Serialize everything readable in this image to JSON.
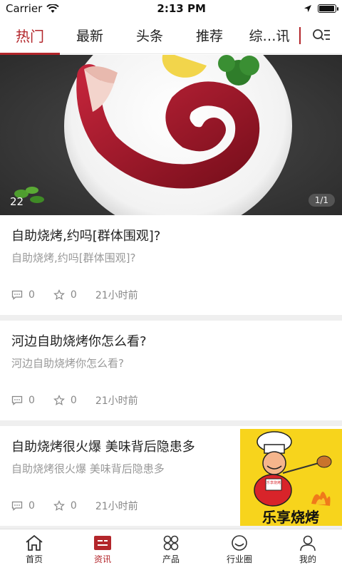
{
  "status": {
    "carrier": "Carrier",
    "time": "2:13 PM",
    "battery_level": 0.95
  },
  "tabs": [
    {
      "label": "热门",
      "active": true
    },
    {
      "label": "最新"
    },
    {
      "label": "头条"
    },
    {
      "label": "推荐"
    },
    {
      "label": "综…讯"
    }
  ],
  "banner": {
    "counter": "1/1",
    "tag": "22"
  },
  "news": [
    {
      "title": "自助烧烤,约吗[群体围观]?",
      "desc": "自助烧烤,约吗[群体围观]?",
      "comments": "0",
      "likes": "0",
      "time": "21小时前"
    },
    {
      "title": "河边自助烧烤你怎么看?",
      "desc": "河边自助烧烤你怎么看?",
      "comments": "0",
      "likes": "0",
      "time": "21小时前"
    },
    {
      "title": "自助烧烤很火爆 美味背后隐患多",
      "desc": "自助烧烤很火爆 美味背后隐患多",
      "comments": "0",
      "likes": "0",
      "time": "21小时前",
      "thumb_text": "乐享烧烤",
      "thumb_small": "乐享烧烤"
    }
  ],
  "bottom_nav": [
    {
      "label": "首页",
      "icon": "home-icon"
    },
    {
      "label": "资讯",
      "icon": "news-icon",
      "active": true
    },
    {
      "label": "产品",
      "icon": "grid-icon"
    },
    {
      "label": "行业圈",
      "icon": "smile-icon"
    },
    {
      "label": "我的",
      "icon": "person-icon"
    }
  ],
  "colors": {
    "accent": "#b3262b"
  }
}
